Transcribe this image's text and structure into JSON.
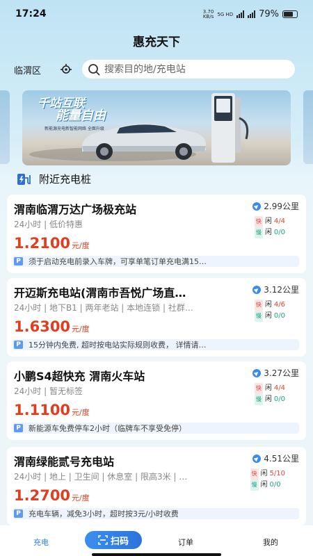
{
  "status": {
    "time": "17:24",
    "speed_value": "3.70",
    "speed_unit": "KB/s",
    "network": "5G HD",
    "battery": "79%"
  },
  "header": {
    "title": "惠充天下"
  },
  "search": {
    "region": "临渭区",
    "placeholder": "搜索目的地/充电站"
  },
  "banner": {
    "title_line1": "千站互联",
    "title_line2": "能量自由",
    "subtitle": "新能源充电新智能网络 全面升级"
  },
  "section": {
    "title": "附近充电桩"
  },
  "price_unit": "元/度",
  "fast_label": "快",
  "slow_label": "慢",
  "free_prefix": "闲",
  "stations": [
    {
      "name": "渭南临渭万达广场极充站",
      "distance": "2.99公里",
      "tags": "24小时 | 低价特惠",
      "price": "1.2100",
      "fast": "4/4",
      "slow": "0/0",
      "note": "须于启动充电前录入车牌，可享单笔订单充电满15…"
    },
    {
      "name": "开迈斯充电站(渭南市吾悦广场直…",
      "distance": "3.12公里",
      "tags": "24小时 | 地下B1 | 两年老站 | 本地连锁 | 社群…",
      "price": "1.6300",
      "fast": "4/6",
      "slow": "0/0",
      "note": "15分钟内免费, 超时按电站实际规则收费， 详情请…"
    },
    {
      "name": "小鹏S4超快充 渭南火车站",
      "distance": "3.27公里",
      "tags": "24小时 | 暂无标签",
      "price": "1.1100",
      "fast": "4/4",
      "slow": "0/0",
      "note": "新能源车免费停车2小时（临牌车不享受免停）"
    },
    {
      "name": "渭南绿能贰号充电站",
      "distance": "4.51公里",
      "tags": "24小时 | 地上 | 卫生间 | 休息室 | 限高3米 | …",
      "price": "1.2700",
      "fast": "5/10",
      "slow": "0/0",
      "note": "充电车辆，减免3小时，超时按3元/小时收费"
    }
  ],
  "tabs": {
    "charge": "充电",
    "scan": "扫码",
    "orders": "订单",
    "mine": "我的"
  },
  "colors": {
    "accent": "#2f7de0",
    "price": "#e23d1e",
    "fast": "#e0453a",
    "slow": "#1fa182"
  }
}
